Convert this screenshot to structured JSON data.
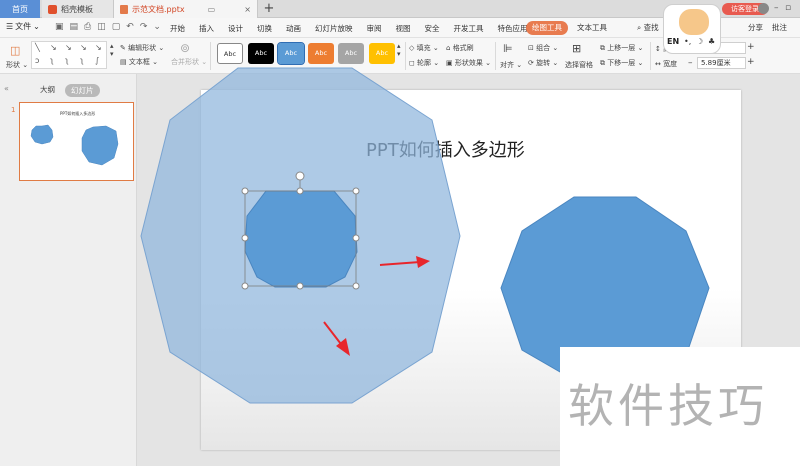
{
  "titlebar": {
    "home_tab": "首页",
    "template_tab": "稻壳模板",
    "doc_tab": "示范文档.pptx",
    "add_tab": "+",
    "login": "访客登录"
  },
  "menubar": {
    "file": "文件",
    "items": [
      "开始",
      "插入",
      "设计",
      "切换",
      "动画",
      "幻灯片放映",
      "审阅",
      "视图",
      "安全",
      "开发工具",
      "特色应用"
    ],
    "active": "绘图工具",
    "text_tools": "文本工具",
    "find": "查找",
    "share": "分享",
    "note": "批注"
  },
  "ribbon": {
    "shape_label": "形状",
    "edit_shape": "编辑形状",
    "text_box": "文本框",
    "merge_shape": "合并形状",
    "style_sample": "Abc",
    "fill": "填充",
    "format_brush": "格式刷",
    "outline": "轮廓",
    "shape_effect": "形状效果",
    "align": "对齐",
    "group": "组合",
    "rotate": "旋转",
    "selection_pane": "选择窗格",
    "bring_forward": "上移一层",
    "send_backward": "下移一层",
    "height_label": "高度",
    "width_label": "宽度",
    "width_value": "5.89厘米",
    "style_colors": [
      "#ffffff",
      "#000000",
      "#5b9bd5",
      "#ed7d31",
      "#a5a5a5",
      "#ffc000"
    ]
  },
  "leftpanel": {
    "outline_tab": "大纲",
    "slides_tab": "幻灯片",
    "slide_number": "1",
    "thumb_title": "PPT如何插入多边形"
  },
  "slide": {
    "title": "PPT如何插入多边形",
    "shape_fill": "#5b9bd5",
    "large_shape_fill": "#a9c7e6",
    "arrow_color": "#e8262c"
  },
  "watermark": {
    "text": "软件技巧"
  },
  "mascot": {
    "lang": "EN"
  }
}
